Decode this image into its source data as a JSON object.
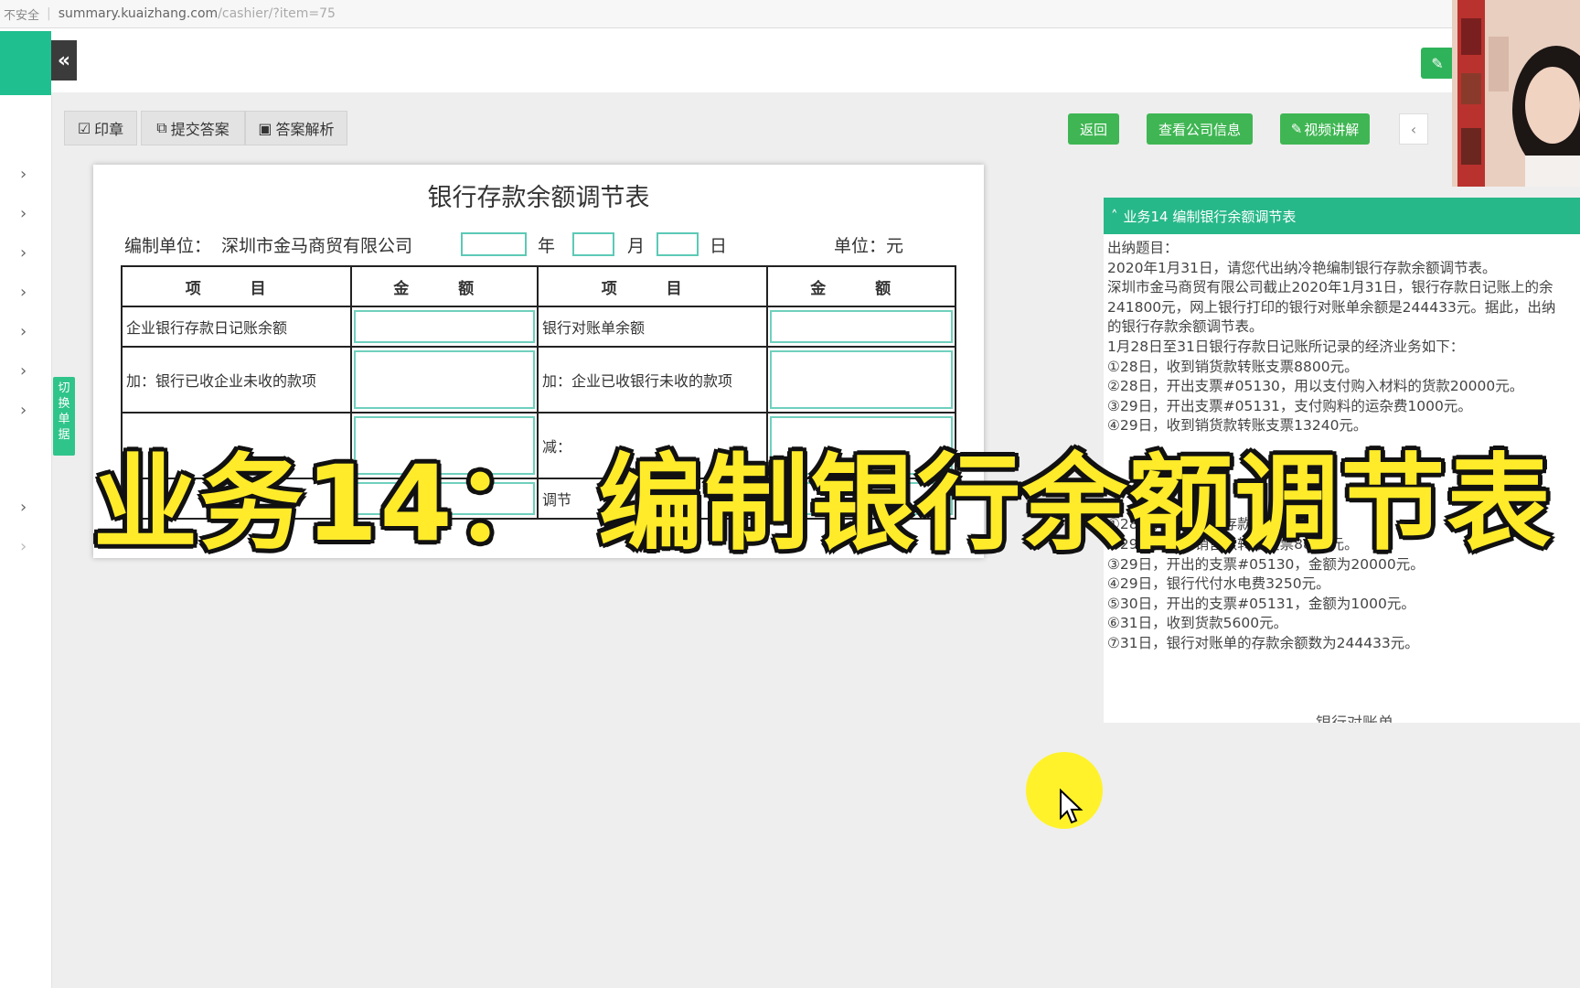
{
  "browser": {
    "insecure_label": "不安全",
    "url_host": "summary.kuaizhang.com",
    "url_path": "/cashier/?item=75"
  },
  "header": {
    "collapse_glyph": "«",
    "edit_glyph": "✎"
  },
  "sidebar": {
    "chevron": "›",
    "switch_label": "切换单据"
  },
  "toolbar": {
    "seal": "印章",
    "submit": "提交答案",
    "analysis": "答案解析",
    "back": "返回",
    "company_info": "查看公司信息",
    "video": "视频讲解",
    "prev": "‹"
  },
  "form": {
    "title": "银行存款余额调节表",
    "unit_label": "编制单位：",
    "company": "深圳市金马商贸有限公司",
    "year": "年",
    "month": "月",
    "day": "日",
    "currency": "单位：元",
    "headers": [
      "项 目",
      "金 额",
      "项 目",
      "金 额"
    ],
    "rows": [
      {
        "left": "企业银行存款日记账余额",
        "right": "银行对账单余额"
      },
      {
        "left": "加：银行已收企业未收的款项",
        "right": "加：企业已收银行未收的款项"
      },
      {
        "left": "",
        "right": "减："
      },
      {
        "left": "额",
        "right": "调节"
      }
    ]
  },
  "overlay": {
    "caption": "业务14： 编制银行余额调节表"
  },
  "task_panel": {
    "header": "业务14 编制银行余额调节表",
    "lines": [
      "出纳题目：",
      "2020年1月31日，请您代出纳冷艳编制银行存款余额调节表。",
      "深圳市金马商贸有限公司截止2020年1月31日，银行存款日记账上的余",
      "241800元，网上银行打印的银行对账单余额是244433元。据此，出纳",
      "的银行存款余额调节表。",
      "1月28日至31日银行存款日记账所记录的经济业务如下：",
      "①28日，收到销货款转账支票8800元。",
      "②28日，开出支票#05130，用以支付购入材料的货款20000元。",
      "③29日，开出支票#05131，支付购料的运杂费1000元。",
      "④29日，收到销货款转账支票13240元。",
      "",
      "",
      "",
      "",
      "①28日，结算银行存款利息1523元。",
      "②29日，收到销售款转账支票8800元。",
      "③29日，开出的支票#05130，金额为20000元。",
      "④29日，银行代付水电费3250元。",
      "⑤30日，开出的支票#05131，金额为1000元。",
      "⑥31日，收到货款5600元。",
      "⑦31日，银行对账单的存款余额数为244433元。"
    ],
    "footer": "银行对账单"
  },
  "colors": {
    "accent_teal": "#27b889",
    "button_green": "#3fb653",
    "caption_yellow": "#ffeb2a"
  },
  "icons": {
    "seal": "edit-icon",
    "submit": "external-link-icon",
    "analysis": "save-icon",
    "video": "pencil-icon"
  }
}
